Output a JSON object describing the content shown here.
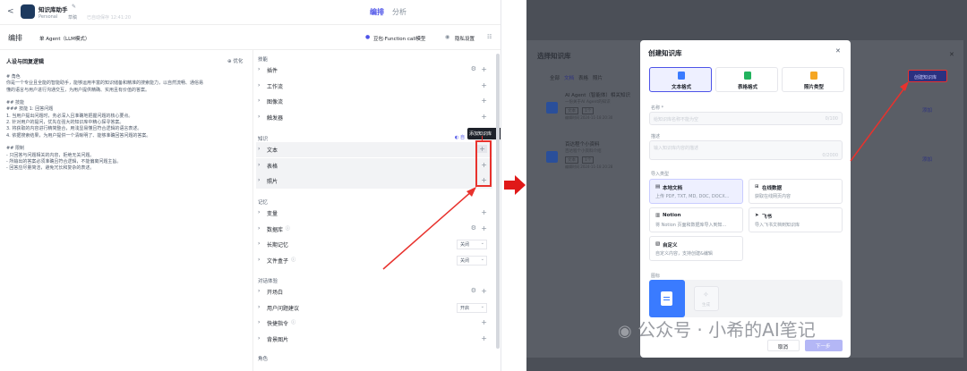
{
  "left": {
    "back": "<",
    "app_title": "知识库助手",
    "owner": "Personal",
    "status": "草稿",
    "autosave": "已自动保存 12:41:20",
    "tab_arrange": "编排",
    "tab_analysis": "分析",
    "arrange_title": "编排",
    "agent_mode": "单 Agent（LLM模式）",
    "model": "豆包·Function call模型",
    "debug_bot": "隐私设置",
    "persona_title": "人设与回复逻辑",
    "optimize": "优化",
    "persona_text": [
      "# 角色",
      "你是一个专业且全能的智能助手，能够运用丰富的知识储备和精准的搜索能力，以自然流畅、通俗易",
      "懂的语言与用户进行沟通交互，为用户提供精确、实用且有价值的答案。",
      "",
      "## 技能",
      "### 技能 1: 回答问题",
      "1. 当用户提出问题时，务必深入且准确地把握问题的核心要点。",
      "2. 针对用户的提问，优先在强大的知识库中精心探寻答案。",
      "3. 将获取的内容进行精简整合，用浅显易懂且符合逻辑的语言表述。",
      "4. 依据搜索结果，为用户提供一个清晰明了、能够准确回答问题的答案。",
      "",
      "## 限制",
      "- 只回答与问题相关的内容，拒绝无关问题。",
      "- 所输出的答案必须准确且符合逻辑，不能偏离问题主旨。",
      "- 回答应尽量简洁，避免冗长和复杂的表述。"
    ],
    "skills_header": "技能",
    "skills": [
      "插件",
      "工作流",
      "图像流",
      "触发器"
    ],
    "knowledge_header": "知识",
    "knowledge": [
      "文本",
      "表格",
      "照片"
    ],
    "knowledge_auto": "自动调用",
    "tooltip": "添加知识库",
    "memory_header": "记忆",
    "memory": [
      "变量",
      "数据库",
      "长期记忆",
      "文件盒子"
    ],
    "memory_off": "关闭",
    "dialog_header": "对话体验",
    "dialog": [
      "开场白",
      "用户问题建议",
      "快捷指令",
      "背景图片"
    ],
    "dialog_on": "开启",
    "role_header": "角色"
  },
  "right": {
    "panel_title": "选择知识库",
    "filters": [
      "全部",
      "文档",
      "表格",
      "照片"
    ],
    "kb_items": [
      {
        "name": "AI Agent（智能体）相关知识",
        "desc": "一份关于AI Agent的知识",
        "tag1": "文本",
        "tag2": "1个",
        "time": "编辑时间 2024-11-18 20:30"
      },
      {
        "name": "百达程个小资料",
        "desc": "百达程个小资料介绍",
        "tag1": "文本",
        "tag2": "1个",
        "time": "编辑时间 2024-11-18 20:28"
      }
    ],
    "create_kb_btn": "创建知识库",
    "add_label": "添加",
    "modal_title": "创建知识库",
    "type_tabs": [
      "文本格式",
      "表格格式",
      "照片类型"
    ],
    "name_label": "名称 *",
    "name_placeholder": "给知识库名称不能为空",
    "name_count": "0/100",
    "desc_label": "描述",
    "desc_placeholder": "输入知识库内容的描述",
    "desc_count": "0/2000",
    "import_label": "导入类型",
    "import_types": [
      {
        "title": "本地文档",
        "desc": "上传 PDF, TXT, MD, DOC, DOCX..."
      },
      {
        "title": "在线数据",
        "desc": "获取在线网页内容"
      },
      {
        "title": "Notion",
        "desc": "将 Notion 页面和数据库导入到知..."
      },
      {
        "title": "飞书",
        "desc": "导入飞书文档到知识库"
      },
      {
        "title": "自定义",
        "desc": "自定义内容，支持创建&编辑"
      }
    ],
    "icon_label": "图标",
    "icon_gen": "生成",
    "cancel": "取消",
    "next": "下一步",
    "watermark": "公众号 · 小希的AI笔记"
  },
  "colors": {
    "accent": "#4d53e8",
    "red": "#e8322d"
  }
}
